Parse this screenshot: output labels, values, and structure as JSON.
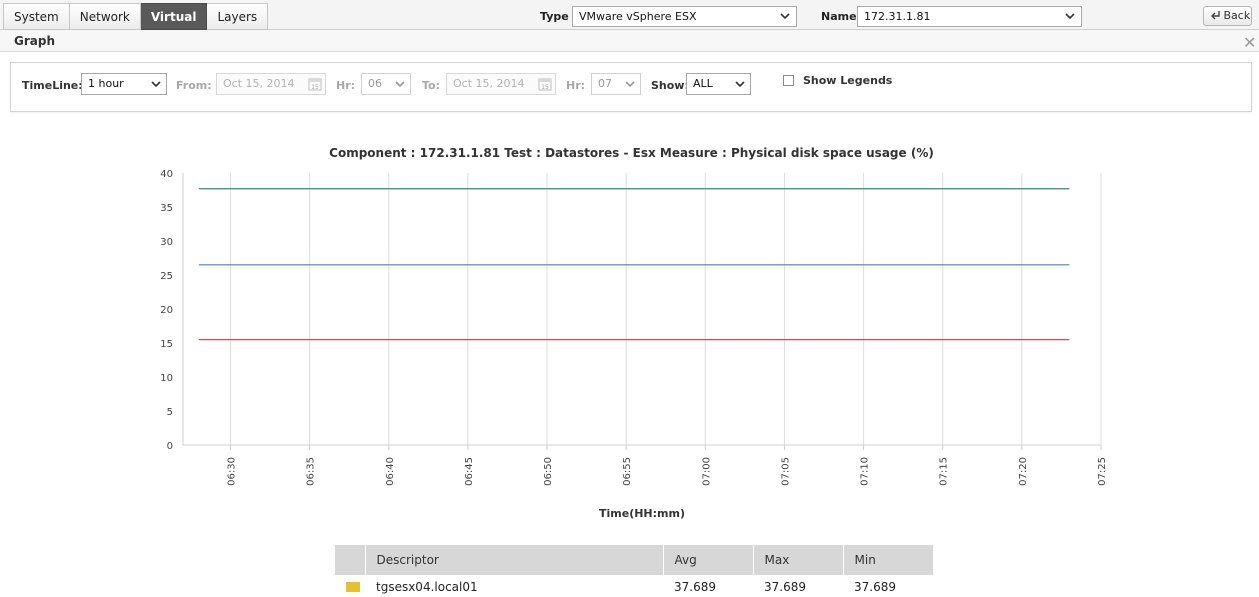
{
  "topbar": {
    "tabs": [
      {
        "label": "System",
        "active": false
      },
      {
        "label": "Network",
        "active": false
      },
      {
        "label": "Virtual",
        "active": true
      },
      {
        "label": "Layers",
        "active": false
      }
    ],
    "type_label": "Type",
    "type_value": "VMware vSphere ESX",
    "name_label": "Name",
    "name_value": "172.31.1.81",
    "back_label": "Back"
  },
  "graph_header": {
    "title": "Graph"
  },
  "controls": {
    "timeline_label": "TimeLine:",
    "timeline_value": "1 hour",
    "from_label": "From:",
    "from_value": "Oct 15, 2014",
    "hr1_label": "Hr:",
    "hr1_value": "06",
    "to_label": "To:",
    "to_value": "Oct 15, 2014",
    "hr2_label": "Hr:",
    "hr2_value": "07",
    "show_label": "Show:",
    "show_value": "ALL",
    "show_legends_label": "Show Legends",
    "show_legends_checked": false,
    "calendar_icon_text": "15"
  },
  "chart_data": {
    "type": "line",
    "title": "Component : 172.31.1.81 Test : Datastores - Esx Measure : Physical disk space usage (%)",
    "xlabel": "Time(HH:mm)",
    "ylabel": "",
    "ylim": [
      0,
      40
    ],
    "yticks": [
      0,
      5,
      10,
      15,
      20,
      25,
      30,
      35,
      40
    ],
    "xticks": [
      "06:30",
      "06:35",
      "06:40",
      "06:45",
      "06:50",
      "06:55",
      "07:00",
      "07:05",
      "07:10",
      "07:15",
      "07:20",
      "07:25"
    ],
    "x_range": [
      "06:27",
      "07:25"
    ],
    "x_data_range": [
      "06:28",
      "07:23"
    ],
    "grid": "vertical",
    "series": [
      {
        "color": "#2e8b6e",
        "values": [
          37.689,
          37.689
        ]
      },
      {
        "color": "#4a7fc9",
        "values": [
          26.5,
          26.5
        ]
      },
      {
        "color": "#e0474c",
        "values": [
          15.5,
          15.5
        ]
      }
    ]
  },
  "legend_table": {
    "headers": [
      "",
      "Descriptor",
      "Avg",
      "Max",
      "Min"
    ],
    "rows": [
      {
        "color": "#e3c22f",
        "descriptor": "tgsesx04.local01",
        "avg": "37.689",
        "max": "37.689",
        "min": "37.689"
      }
    ]
  }
}
